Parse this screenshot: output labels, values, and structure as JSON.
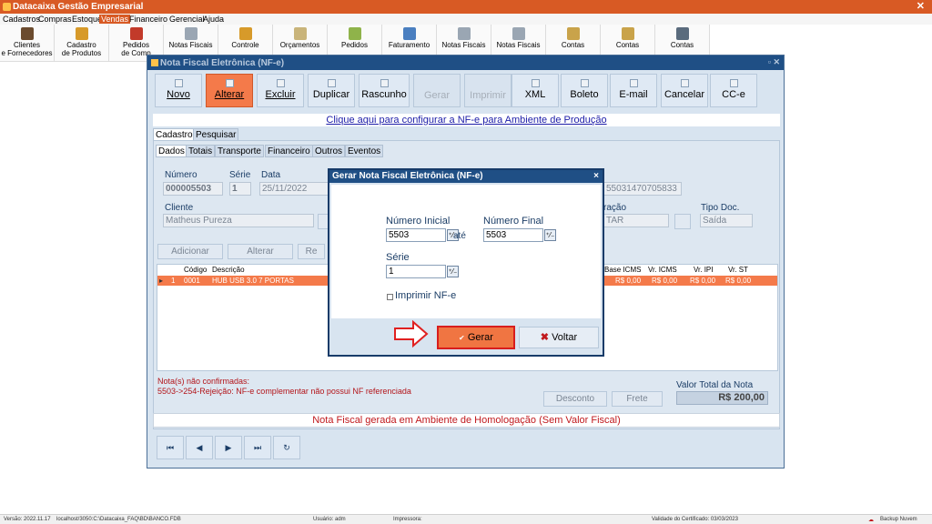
{
  "app": {
    "title": "Datacaixa Gestão Empresarial",
    "close_glyph": "✕"
  },
  "menu": [
    "Cadastros",
    "Compras",
    "Estoque",
    "Vendas",
    "Financeiro",
    "Gerencial",
    "Ajuda"
  ],
  "menu_active": "Vendas",
  "toolbar": [
    {
      "line1": "Clientes",
      "line2": "e Fornecedores",
      "icon": "people-icon"
    },
    {
      "line1": "Cadastro",
      "line2": "de Produtos",
      "icon": "products-icon"
    },
    {
      "line1": "Pedidos",
      "line2": "de Comp",
      "icon": "purchase-order-icon"
    },
    {
      "line1": "Notas Fiscais",
      "line2": "",
      "icon": "invoice-icon"
    },
    {
      "line1": "Controle",
      "line2": "",
      "icon": "control-icon"
    },
    {
      "line1": "Orçamentos",
      "line2": "",
      "icon": "quote-icon"
    },
    {
      "line1": "Pedidos",
      "line2": "",
      "icon": "sales-order-icon"
    },
    {
      "line1": "Faturamento",
      "line2": "",
      "icon": "billing-icon"
    },
    {
      "line1": "Notas Fiscais",
      "line2": "",
      "icon": "invoice-icon"
    },
    {
      "line1": "Notas Fiscais",
      "line2": "",
      "icon": "invoice-icon"
    },
    {
      "line1": "Contas",
      "line2": "",
      "icon": "accounts-icon"
    },
    {
      "line1": "Contas",
      "line2": "",
      "icon": "accounts-icon"
    },
    {
      "line1": "Contas",
      "line2": "",
      "icon": "accounts-icon"
    }
  ],
  "nf_window": {
    "title": "Nota Fiscal Eletrônica (NF-e)",
    "window_controls": "▫ ✕",
    "actions": [
      {
        "label": "Novo",
        "state": "normal"
      },
      {
        "label": "Alterar",
        "state": "highlight"
      },
      {
        "label": "Excluir",
        "state": "normal"
      },
      {
        "label": "Duplicar",
        "state": "normal"
      },
      {
        "label": "Rascunho",
        "state": "normal"
      },
      {
        "label": "Gerar",
        "state": "disabled"
      },
      {
        "label": "Imprimir",
        "state": "disabled"
      },
      {
        "label": "XML",
        "state": "normal"
      },
      {
        "label": "Boleto",
        "state": "normal"
      },
      {
        "label": "E-mail",
        "state": "normal"
      },
      {
        "label": "Cancelar",
        "state": "normal"
      },
      {
        "label": "CC-e",
        "state": "normal"
      }
    ],
    "config_link": "Clique aqui para configurar a NF-e para Ambiente de Produção",
    "tabs1": [
      "Cadastro",
      "Pesquisar"
    ],
    "tabs2": [
      "Dados",
      "Totais",
      "Transporte",
      "Financeiro",
      "Outros",
      "Eventos"
    ],
    "fields": {
      "numero_label": "Número",
      "numero_value": "000005503",
      "serie_label": "Série",
      "serie_value": "1",
      "data_label": "Data",
      "data_value": "25/11/2022",
      "chave_value": "55031470705833",
      "cliente_label": "Cliente",
      "cliente_value": "Matheus Pureza",
      "operacao_label": "ração",
      "operacao_value": "TAR",
      "tipodoc_label": "Tipo Doc.",
      "tipodoc_value": "Saída"
    },
    "item_buttons": [
      "Adicionar",
      "Alterar",
      "Re"
    ],
    "grid_headers": [
      "Código",
      "Descrição",
      "Base ICMS",
      "Vr. ICMS",
      "Vr. IPI",
      "Vr. ST"
    ],
    "grid_row": {
      "marker": "▸",
      "index": "1",
      "code": "0001",
      "desc": "HUB USB 3.0 7 PORTAS",
      "base": "R$ 0,00",
      "icms": "R$ 0,00",
      "ipi": "R$ 0,00",
      "st": "R$ 0,00"
    },
    "errors": {
      "line1": "Nota(s) não confirmadas:",
      "line2": "5503->254-Rejeição: NF-e complementar não possui NF referenciada"
    },
    "desconto": "Desconto",
    "frete": "Frete",
    "total_label": "Valor Total da Nota",
    "total_value": "R$ 200,00",
    "homolog_text": "Nota Fiscal gerada em Ambiente de Homologação (Sem Valor Fiscal)",
    "nav": [
      "⏮",
      "◀",
      "▶",
      "⏭",
      "↻"
    ]
  },
  "dialog": {
    "title": "Gerar Nota Fiscal Eletrônica (NF-e)",
    "close": "×",
    "inicial_label": "Número Inicial",
    "inicial_value": "5503",
    "ate": "até",
    "final_label": "Número Final",
    "final_value": "5503",
    "serie_label": "Série",
    "serie_value": "1",
    "imprimir_label": "Imprimir NF-e",
    "calc_glyph": "⁺⁄₋",
    "gerar_check": "✔",
    "gerar_label": "Gerar",
    "voltar_x": "✖",
    "voltar_label": "Voltar"
  },
  "status": {
    "versao": "Versão: 2022.11.17",
    "banco": "localhost/3050:C:\\Datacaixa_FAQ\\BD\\BANCO.FDB",
    "usuario": "Usuário: adm",
    "impressora": "Impressora:",
    "validade": "Validade do Certificado: 03/03/2023",
    "backup": "Backup Nuvem"
  },
  "colors": {
    "accent": "#d85a24",
    "window_title": "#1f4f85",
    "highlight_button": "#f47a4a",
    "error_red": "#c0191d"
  }
}
